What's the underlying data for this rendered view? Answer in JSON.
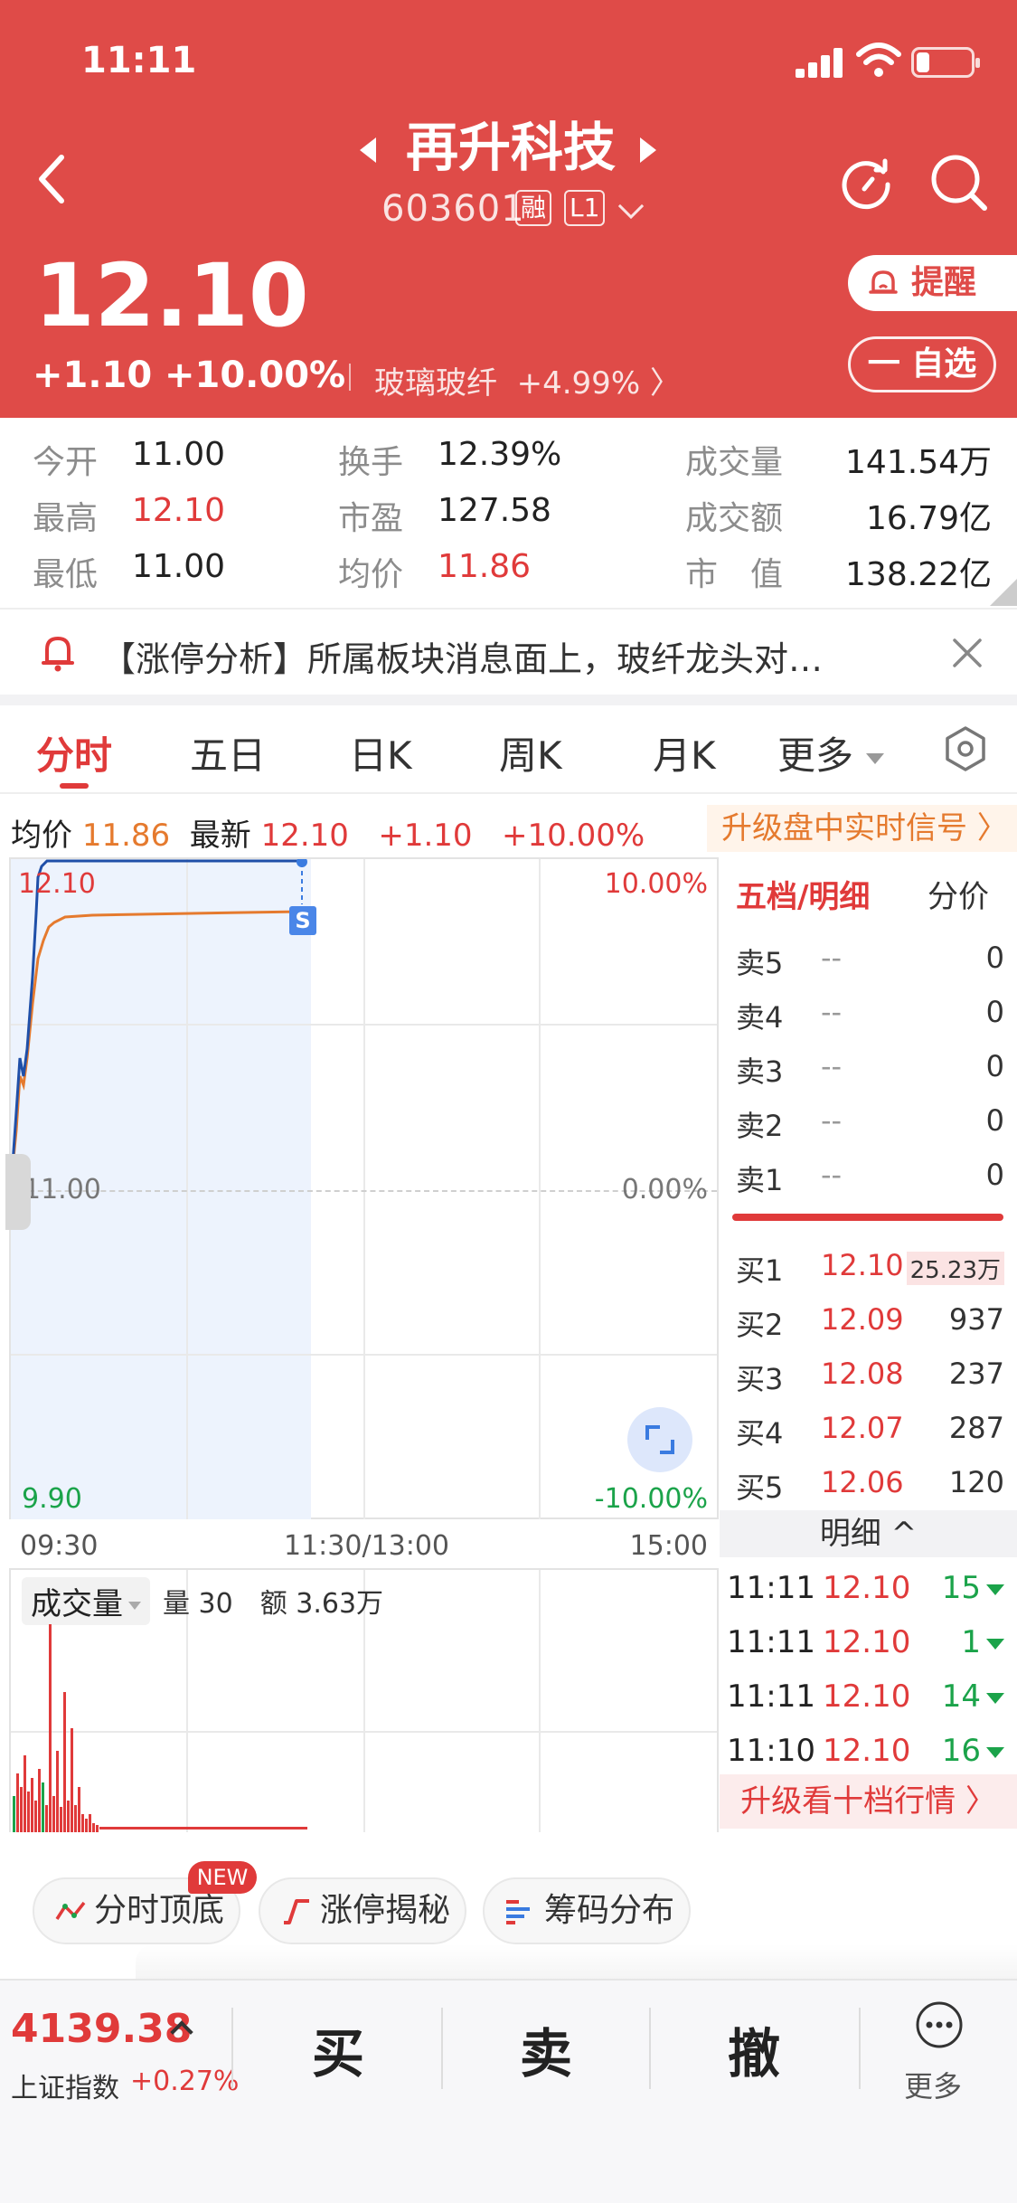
{
  "status": {
    "time": "11:11"
  },
  "header": {
    "stock_name": "再升科技",
    "code": "603601",
    "tag_margin": "融",
    "tag_level": "L1",
    "price": "12.10",
    "change": "+1.10",
    "change_pct": "+10.00%",
    "sector_name": "玻璃玻纤",
    "sector_change": "+4.99%",
    "remind_label": "提醒",
    "watch_label": "一 自选"
  },
  "stats": {
    "open_label": "今开",
    "open": "11.00",
    "high_label": "最高",
    "high": "12.10",
    "low_label": "最低",
    "low": "11.00",
    "turnover_label": "换手",
    "turnover": "12.39%",
    "pe_label": "市盈",
    "pe": "127.58",
    "avg_label": "均价",
    "avg": "11.86",
    "volume_label": "成交量",
    "volume": "141.54万",
    "amount_label": "成交额",
    "amount": "16.79亿",
    "mcap_label": "市　值",
    "mcap": "138.22亿"
  },
  "banner": {
    "text": "【涨停分析】所属板块消息面上，玻纤龙头对…"
  },
  "tabs": {
    "t1": "分时",
    "t2": "五日",
    "t3": "日K",
    "t4": "周K",
    "t5": "月K",
    "more": "更多"
  },
  "info": {
    "avg_label": "均价",
    "avg": "11.86",
    "latest_label": "最新",
    "latest": "12.10",
    "chg": "+1.10",
    "pct": "+10.00%",
    "upgrade": "升级盘中实时信号 〉"
  },
  "chart": {
    "y_top": "12.10",
    "y_top_pct": "10.00%",
    "y_mid": "11.00",
    "y_mid_pct": "0.00%",
    "y_bot": "9.90",
    "y_bot_pct": "-10.00%",
    "t_start": "09:30",
    "t_mid": "11:30/13:00",
    "t_end": "15:00",
    "marker": "S",
    "vol_label": "成交量",
    "vol_info": "量 30　额 3.63万"
  },
  "orderbook": {
    "title": "五档/明细",
    "sub": "分价",
    "asks": [
      {
        "n": "卖5",
        "p": "--",
        "v": "0"
      },
      {
        "n": "卖4",
        "p": "--",
        "v": "0"
      },
      {
        "n": "卖3",
        "p": "--",
        "v": "0"
      },
      {
        "n": "卖2",
        "p": "--",
        "v": "0"
      },
      {
        "n": "卖1",
        "p": "--",
        "v": "0"
      }
    ],
    "bids": [
      {
        "n": "买1",
        "p": "12.10",
        "v": "25.23万"
      },
      {
        "n": "买2",
        "p": "12.09",
        "v": "937"
      },
      {
        "n": "买3",
        "p": "12.08",
        "v": "237"
      },
      {
        "n": "买4",
        "p": "12.07",
        "v": "287"
      },
      {
        "n": "买5",
        "p": "12.06",
        "v": "120"
      }
    ],
    "detail_label": "明细 ^",
    "ticks": [
      {
        "t": "11:11",
        "p": "12.10",
        "q": "15"
      },
      {
        "t": "11:11",
        "p": "12.10",
        "q": "1"
      },
      {
        "t": "11:11",
        "p": "12.10",
        "q": "14"
      },
      {
        "t": "11:10",
        "p": "12.10",
        "q": "16"
      }
    ],
    "upgrade": "升级看十档行情 〉"
  },
  "tools": {
    "t1": "分时顶底",
    "t2": "涨停揭秘",
    "t3": "筹码分布",
    "new_badge": "NEW"
  },
  "bottom": {
    "index_value": "4139.38",
    "index_name": "上证指数",
    "index_change": "+0.27%",
    "buy": "买",
    "sell": "卖",
    "cancel": "撤",
    "more": "更多"
  },
  "colors": {
    "header": "#df4b48",
    "up": "#e03a3a",
    "down": "#1ba34a",
    "avg_line": "#e57a2e",
    "price_line": "#1f4fa8"
  }
}
